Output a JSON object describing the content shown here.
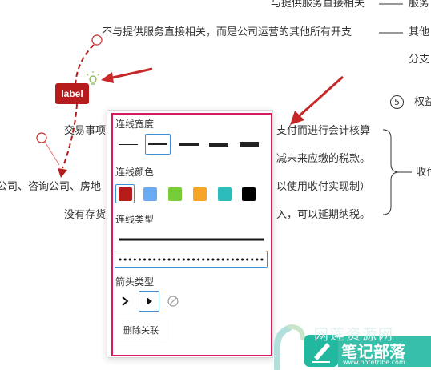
{
  "background": {
    "lines": [
      {
        "text": "与提供服务直接相关"
      },
      {
        "text": "服务"
      },
      {
        "text": "不与提供服务直接相关，而是公司运营的其他所有开支"
      },
      {
        "text": "其他"
      },
      {
        "text": "分支"
      },
      {
        "text": "权益"
      },
      {
        "text": "交易事项"
      },
      {
        "text": "支付而进行会计核算"
      },
      {
        "text": "减未来应缴的税款。"
      },
      {
        "text": "收付"
      },
      {
        "text": "公司、咨询公司、房地"
      },
      {
        "text": "以使用收付实现制）"
      },
      {
        "text": "没有存货"
      },
      {
        "text": "入，可以延期纳税。"
      }
    ],
    "circle_number": "5"
  },
  "label_tag": "label",
  "panel": {
    "line_width_title": "连线宽度",
    "line_color_title": "连线颜色",
    "line_type_title": "连线类型",
    "arrow_type_title": "箭头类型",
    "delete_label": "删除关联",
    "widths": [
      1,
      2,
      3,
      4,
      5
    ],
    "selected_width_index": 1,
    "colors": [
      "#b71c1c",
      "#6aaaf0",
      "#77cc3a",
      "#f5a623",
      "#2cbcbc",
      "#000000"
    ],
    "selected_color_index": 0,
    "line_types": [
      "solid",
      "dotted"
    ],
    "selected_line_type_index": 1,
    "arrow_types": [
      "open-arrow",
      "filled-arrow",
      "none"
    ],
    "selected_arrow_index": 1
  },
  "watermark": {
    "brand": "笔记部落",
    "url": "www.notetribe.com",
    "faded": "网莲资源网"
  }
}
